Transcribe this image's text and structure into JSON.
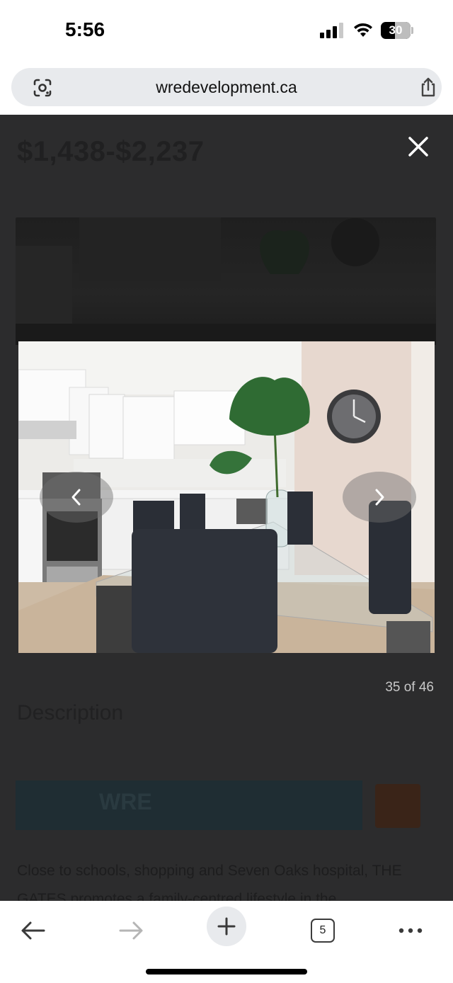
{
  "status_bar": {
    "time": "5:56",
    "battery_level": "30"
  },
  "browser": {
    "url": "wredevelopment.ca"
  },
  "listing": {
    "price": "$1,438-$2,237",
    "description_heading": "Description",
    "banner_text": "WRE",
    "body_text": "Close to schools, shopping and Seven Oaks hospital, THE GATES promotes a family-centred lifestyle in the"
  },
  "lightbox": {
    "counter": "35 of 46",
    "current": 35,
    "total": 46
  },
  "toolbar": {
    "open_tabs": "5"
  }
}
